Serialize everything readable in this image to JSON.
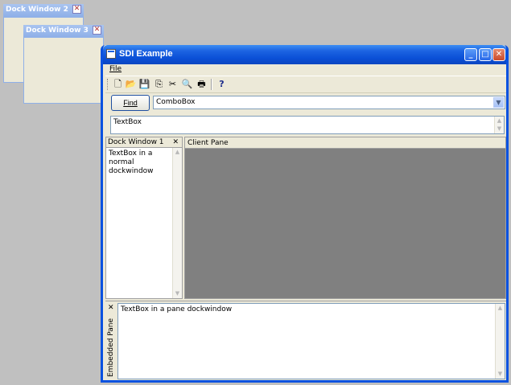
{
  "dock_window_2": {
    "title": "Dock Window 2",
    "close_glyph": "✕"
  },
  "dock_window_3": {
    "title": "Dock Window 3",
    "close_glyph": "✕"
  },
  "main_window": {
    "title": "SDI Example",
    "controls": {
      "minimize": "_",
      "maximize": "□",
      "close": "✕"
    }
  },
  "menu": {
    "file": "File"
  },
  "toolbar": {
    "icons": [
      "new-file-icon",
      "open-folder-icon",
      "save-icon",
      "copy-icon",
      "cut-icon",
      "print-preview-icon",
      "print-icon",
      "help-icon"
    ]
  },
  "find_bar": {
    "find_button": "Find",
    "combo_value": "ComboBox"
  },
  "textbox_top": {
    "value": "TextBox"
  },
  "dock_window_1": {
    "title": "Dock Window 1",
    "close_glyph": "✕",
    "text": "TextBox in a normal dockwindow"
  },
  "client_pane": {
    "title": "Client Pane"
  },
  "embedded_pane": {
    "label": "Embedded Pane",
    "close_glyph": "✕",
    "text": "TextBox in a pane dockwindow"
  },
  "colors": {
    "desktop": "#c0c0c0",
    "xp_blue": "#0a52e0",
    "client_gray": "#808080",
    "face": "#ece9d8"
  }
}
